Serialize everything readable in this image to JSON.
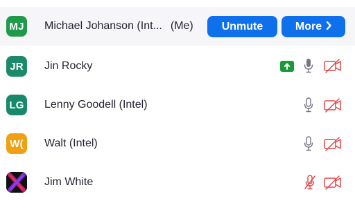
{
  "colors": {
    "accent": "#0e71eb",
    "muted_red": "#e34646",
    "share_green": "#1a9a3a"
  },
  "participants": [
    {
      "initials": "MJ",
      "name": "Michael Johanson (Int...",
      "suffix": "(Me)",
      "avatar_color": "#1f9a4a",
      "mic": "muted",
      "video": "off"
    },
    {
      "initials": "JR",
      "name": "Jin Rocky",
      "avatar_color": "#1a8a6a",
      "sharing": true,
      "mic": "on",
      "video": "off"
    },
    {
      "initials": "LG",
      "name": "Lenny Goodell (Intel)",
      "avatar_color": "#168a6a",
      "mic": "on",
      "video": "off"
    },
    {
      "initials": "W(",
      "name": "Walt (Intel)",
      "avatar_color": "#f0a010",
      "mic": "on",
      "video": "off"
    },
    {
      "initials": "",
      "name": "Jim White",
      "avatar_image": "x-logo",
      "mic": "muted",
      "video": "off"
    }
  ],
  "actions": {
    "unmute_label": "Unmute",
    "more_label": "More",
    "more_icon": "chevron-right-icon"
  }
}
